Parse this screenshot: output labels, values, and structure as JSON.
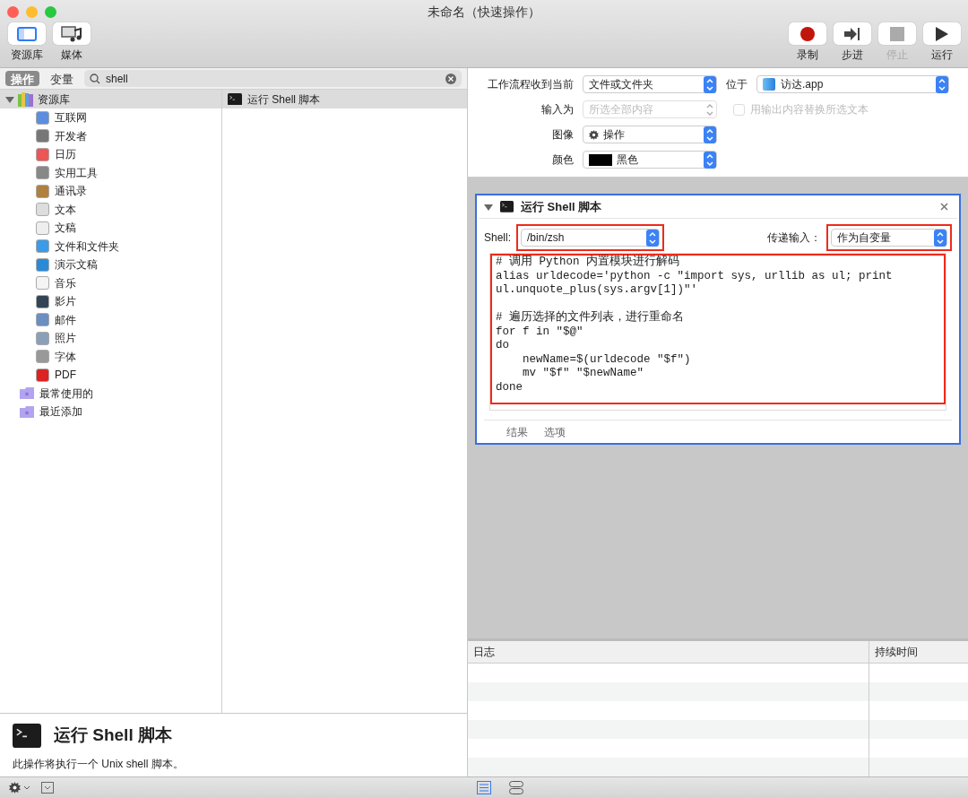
{
  "window": {
    "title": "未命名（快速操作）"
  },
  "toolbar_left": [
    {
      "label": "资源库",
      "kind": "library"
    },
    {
      "label": "媒体",
      "kind": "media"
    }
  ],
  "toolbar_right": [
    {
      "label": "录制",
      "kind": "record",
      "disabled": false
    },
    {
      "label": "步进",
      "kind": "step",
      "disabled": false
    },
    {
      "label": "停止",
      "kind": "stop",
      "disabled": true
    },
    {
      "label": "运行",
      "kind": "run",
      "disabled": false
    }
  ],
  "left_tabs": [
    {
      "label": "操作",
      "selected": true
    },
    {
      "label": "变量",
      "selected": false
    }
  ],
  "search": {
    "value": "shell"
  },
  "library": {
    "label": "资源库",
    "expanded": true,
    "children": [
      {
        "label": "互联网"
      },
      {
        "label": "开发者"
      },
      {
        "label": "日历"
      },
      {
        "label": "实用工具"
      },
      {
        "label": "通讯录"
      },
      {
        "label": "文本"
      },
      {
        "label": "文稿"
      },
      {
        "label": "文件和文件夹"
      },
      {
        "label": "演示文稿"
      },
      {
        "label": "音乐"
      },
      {
        "label": "影片"
      },
      {
        "label": "邮件"
      },
      {
        "label": "照片"
      },
      {
        "label": "字体"
      },
      {
        "label": "PDF"
      }
    ]
  },
  "smart_folders": [
    {
      "label": "最常使用的"
    },
    {
      "label": "最近添加"
    }
  ],
  "results": [
    {
      "label": "运行 Shell 脚本"
    }
  ],
  "description": {
    "title": "运行 Shell 脚本",
    "text": "此操作将执行一个 Unix shell 脚本。"
  },
  "workflow_settings": [
    {
      "label": "工作流程收到当前",
      "value": "文件或文件夹",
      "disabled": false,
      "kind": "plain"
    },
    {
      "label": "输入为",
      "value": "所选全部内容",
      "disabled": true,
      "kind": "plain"
    },
    {
      "label": "图像",
      "value": "操作",
      "disabled": false,
      "kind": "image"
    },
    {
      "label": "颜色",
      "value": "黑色",
      "disabled": false,
      "kind": "color"
    }
  ],
  "location": {
    "label": "位于",
    "value": "访达.app"
  },
  "replace_checkbox": {
    "label": "用输出内容替换所选文本",
    "checked": false,
    "disabled": true
  },
  "action": {
    "title": "运行 Shell 脚本",
    "expanded": true,
    "shell_label": "Shell:",
    "shell_value": "/bin/zsh",
    "pass_label": "传递输入：",
    "pass_value": "作为自变量",
    "code": "# 调用 Python 内置模块进行解码\nalias urldecode='python -c \"import sys, urllib as ul; print\nul.unquote_plus(sys.argv[1])\"'\n\n# 遍历选择的文件列表，进行重命名\nfor f in \"$@\"\ndo\n    newName=$(urldecode \"$f\")\n    mv \"$f\" \"$newName\"\ndone",
    "footer_buttons": [
      "结果",
      "选项"
    ]
  },
  "log": {
    "columns": [
      "日志",
      "持续时间"
    ]
  },
  "bottom_view_toggles": [
    {
      "kind": "list",
      "selected": true
    },
    {
      "kind": "split",
      "selected": false
    }
  ]
}
